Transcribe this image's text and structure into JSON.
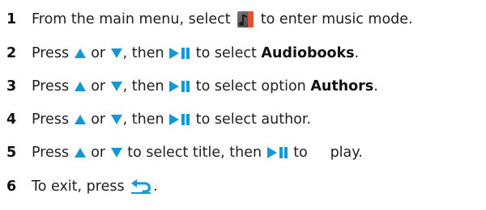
{
  "colors": {
    "text": "#1f1f1f",
    "arrow": "#1398d5",
    "back_arrow": "#1398d5"
  },
  "icons": {
    "music_mode": "music-mode-icon",
    "up": "up-arrow-icon",
    "down": "down-arrow-icon",
    "play_pause": "play-pause-icon",
    "back": "back-icon"
  },
  "steps": [
    {
      "number": "1",
      "text_a": "From the main menu, select ",
      "text_b": " to enter music mode."
    },
    {
      "number": "2",
      "text_a": "Press ",
      "text_b": " or ",
      "text_c": ", then ",
      "text_d": " to select ",
      "bold": "Audiobooks",
      "text_e": "."
    },
    {
      "number": "3",
      "text_a": "Press ",
      "text_b": " or ",
      "text_c": ", then ",
      "text_d": " to select option ",
      "bold": "Authors",
      "text_e": "."
    },
    {
      "number": "4",
      "text_a": "Press ",
      "text_b": " or ",
      "text_c": ", then ",
      "text_d": " to select author."
    },
    {
      "number": "5",
      "text_a": "Press ",
      "text_b": " or ",
      "text_c": " to select title, then ",
      "text_d": " to     play."
    },
    {
      "number": "6",
      "text_a": "To exit, press ",
      "text_b": "."
    }
  ]
}
